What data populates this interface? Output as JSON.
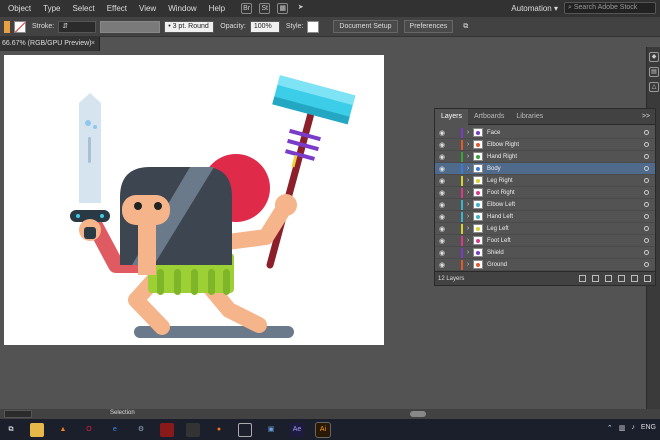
{
  "menubar": {
    "items": [
      "Object",
      "Type",
      "Select",
      "Effect",
      "View",
      "Window",
      "Help"
    ],
    "bridge_label": "Br",
    "stock_label": "St",
    "workspace": "Automation",
    "search_placeholder": "Search Adobe Stock"
  },
  "controlbar": {
    "stroke_label": "Stroke:",
    "brush_value": "3 pt. Round",
    "opacity_label": "Opacity:",
    "opacity_value": "100%",
    "style_label": "Style:",
    "document_setup": "Document Setup",
    "preferences": "Preferences"
  },
  "document_tab": {
    "title": "66.67% (RGB/GPU Preview)",
    "close": "×"
  },
  "layers_panel": {
    "tabs": [
      "Layers",
      "Artboards",
      "Libraries"
    ],
    "menu": ">>",
    "layers": [
      {
        "name": "Face",
        "color": "#7a3cc8",
        "selected": false
      },
      {
        "name": "Elbow Right",
        "color": "#e05a2a",
        "selected": false
      },
      {
        "name": "Hand Right",
        "color": "#3aa33a",
        "selected": false
      },
      {
        "name": "Body",
        "color": "#3b7bd6",
        "selected": true
      },
      {
        "name": "Leg Right",
        "color": "#d6d030",
        "selected": false
      },
      {
        "name": "Foot Right",
        "color": "#d83a8a",
        "selected": false
      },
      {
        "name": "Elbow Left",
        "color": "#3ab5c8",
        "selected": false
      },
      {
        "name": "Hand Left",
        "color": "#3ab5c8",
        "selected": false
      },
      {
        "name": "Leg Left",
        "color": "#d6d030",
        "selected": false
      },
      {
        "name": "Foot Left",
        "color": "#d83a8a",
        "selected": false
      },
      {
        "name": "Shield",
        "color": "#7a3cc8",
        "selected": false
      },
      {
        "name": "Ground",
        "color": "#e05a2a",
        "selected": false
      }
    ],
    "count_label": "12 Layers"
  },
  "statusbar": {
    "mode": "Selection"
  },
  "taskbar": {
    "language": "ENG"
  },
  "colors": {
    "helmet": "#3d4550",
    "skin": "#f5b48a",
    "arm": "#e05a62",
    "skirt": "#9dd035",
    "shield": "#e02a4a",
    "sword": "#d6e4f0",
    "hammer_head": "#3ccde8",
    "handle": "#8b1f2a",
    "ground": "#6b7a8a"
  }
}
